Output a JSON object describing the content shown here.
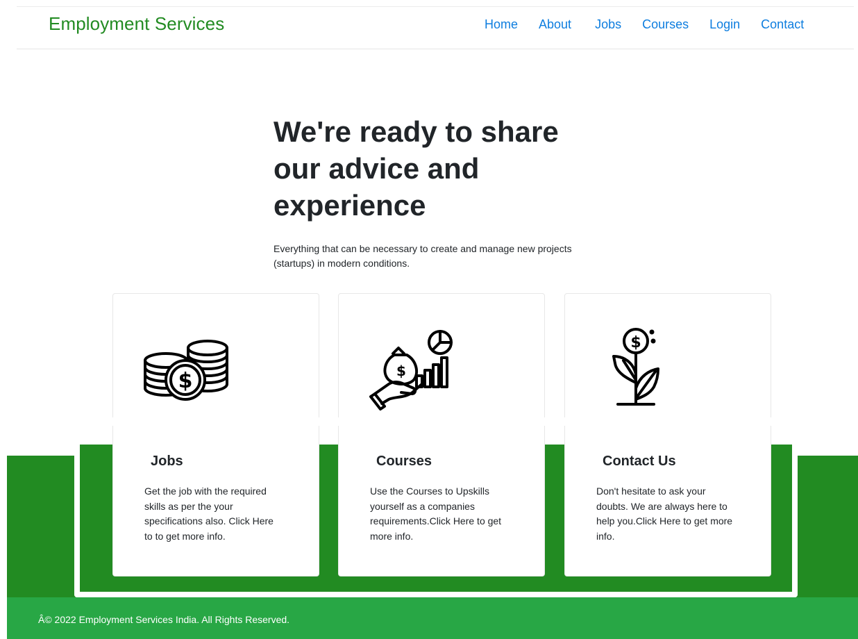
{
  "brand": "Employment Services",
  "nav": [
    {
      "label": "Home"
    },
    {
      "label": "About"
    },
    {
      "label": "Jobs"
    },
    {
      "label": "Courses"
    },
    {
      "label": "Login"
    },
    {
      "label": "Contact"
    }
  ],
  "hero": {
    "heading": "We're ready to share our advice and experience",
    "subtext": "Everything that can be necessary to create and manage new projects (startups) in modern conditions."
  },
  "cards": [
    {
      "title": "Jobs",
      "text": "Get the job with the required skills as per the your specifications also. Click Here to to get more info.",
      "icon": "coins-icon"
    },
    {
      "title": "Courses",
      "text": "Use the Courses to Upskills yourself as a companies requirements.Click Here to get more info.",
      "icon": "money-growth-icon"
    },
    {
      "title": "Contact Us",
      "text": "Don't hesitate to ask your doubts. We are always here to help you.Click Here to get more info.",
      "icon": "money-plant-icon"
    }
  ],
  "footer": {
    "text": "Â© 2022 Employment Services India. All Rights Reserved."
  },
  "colors": {
    "brand_green": "#228b22",
    "footer_green": "#28a745",
    "link_blue": "#0d7ddf"
  }
}
